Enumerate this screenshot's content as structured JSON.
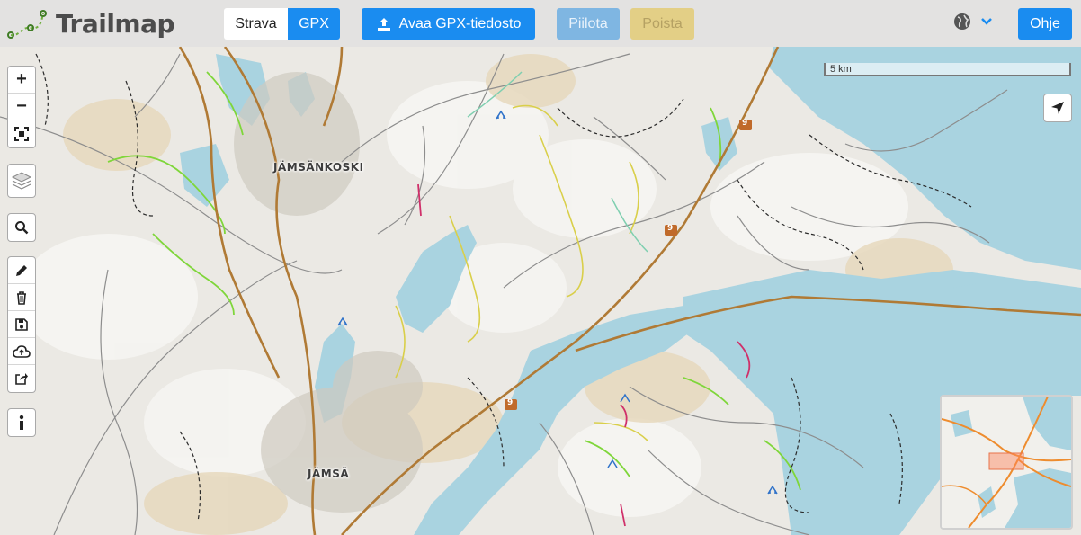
{
  "app": {
    "name": "Trailmap"
  },
  "toolbar": {
    "strava_label": "Strava",
    "gpx_label": "GPX",
    "open_gpx_label": "Avaa GPX-tiedosto",
    "hide_label": "Piilota",
    "delete_label": "Poista",
    "help_label": "Ohje",
    "language_icon": "globe-icon"
  },
  "map": {
    "place_labels": [
      "JÄMSÄNKOSKI",
      "JÄMSÄ"
    ],
    "road_shields": [
      "9",
      "9",
      "9"
    ],
    "scale_label": "5 km"
  },
  "controls": {
    "zoom_in": "+",
    "zoom_out": "−",
    "icons": [
      "fullscreen-icon",
      "layers-icon",
      "search-icon",
      "pencil-icon",
      "trash-icon",
      "save-icon",
      "upload-cloud-icon",
      "share-icon",
      "info-icon",
      "locate-arrow-icon"
    ]
  },
  "colors": {
    "accent": "#1a8cf0",
    "water": "#a9d3e0",
    "road": "#c48a3e",
    "trail_green": "#7fd63a",
    "trail_yellow": "#d9cf4a",
    "trail_red": "#d0306a"
  }
}
